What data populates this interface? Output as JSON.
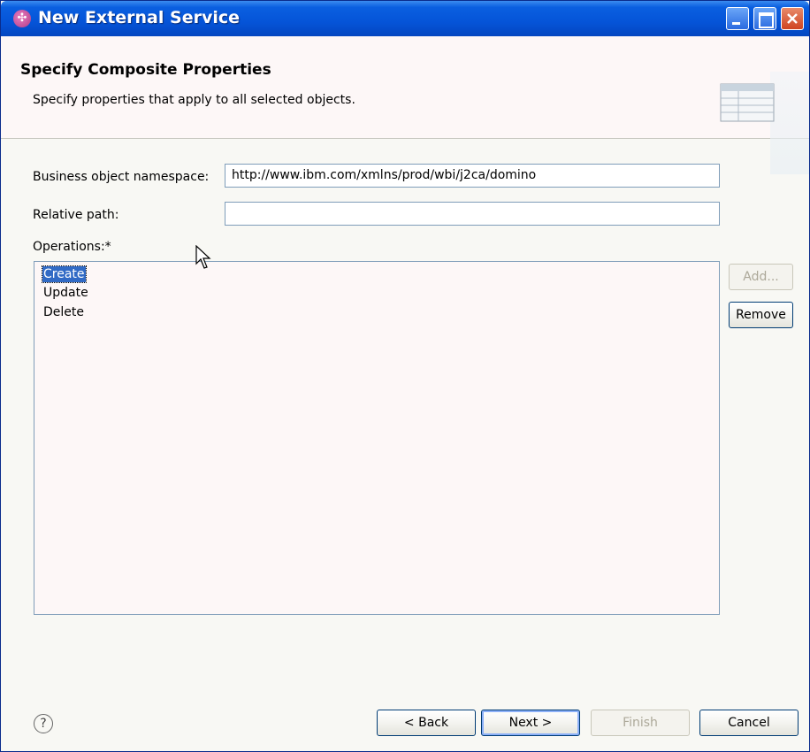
{
  "window": {
    "title": "New External Service"
  },
  "banner": {
    "title": "Specify Composite Properties",
    "description": "Specify properties that apply to all selected objects."
  },
  "form": {
    "namespace_label": "Business object namespace:",
    "namespace_value": "http://www.ibm.com/xmlns/prod/wbi/j2ca/domino",
    "relative_path_label": "Relative path:",
    "relative_path_value": "",
    "operations_label": "Operations:*"
  },
  "operations": {
    "items": [
      "Create",
      "Update",
      "Delete"
    ],
    "selected": "Create"
  },
  "side_buttons": {
    "add": "Add...",
    "remove": "Remove"
  },
  "footer": {
    "help_icon": "help-icon",
    "back": "< Back",
    "next": "Next >",
    "finish": "Finish",
    "cancel": "Cancel"
  },
  "colors": {
    "titlebar": "#0554d8",
    "selection": "#316ac5",
    "banner_bg": "#fdf7f7"
  }
}
